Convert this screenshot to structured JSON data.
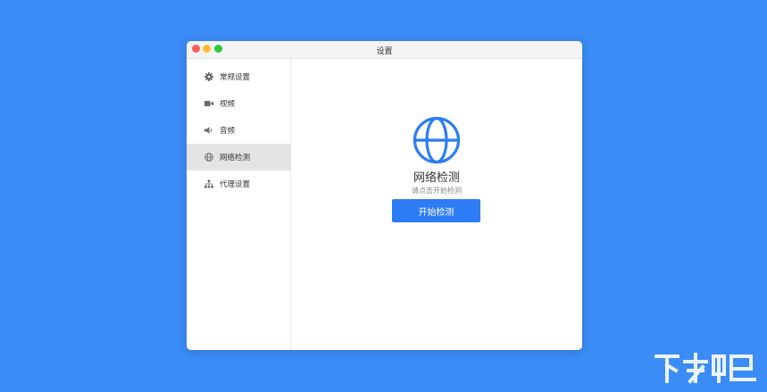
{
  "window": {
    "title": "设置"
  },
  "sidebar": {
    "items": [
      {
        "label": "常规设置",
        "icon": "gear-icon",
        "active": false
      },
      {
        "label": "视频",
        "icon": "video-camera-icon",
        "active": false
      },
      {
        "label": "音频",
        "icon": "speaker-icon",
        "active": false
      },
      {
        "label": "网络检测",
        "icon": "globe-icon",
        "active": true
      },
      {
        "label": "代理设置",
        "icon": "network-tree-icon",
        "active": false
      }
    ]
  },
  "main": {
    "title": "网络检测",
    "hint": "请点击开始检测",
    "start_button": "开始检测"
  },
  "colors": {
    "background": "#3b8cf6",
    "accent": "#2d7cf5",
    "sidebar_active": "#e4e4e4"
  }
}
